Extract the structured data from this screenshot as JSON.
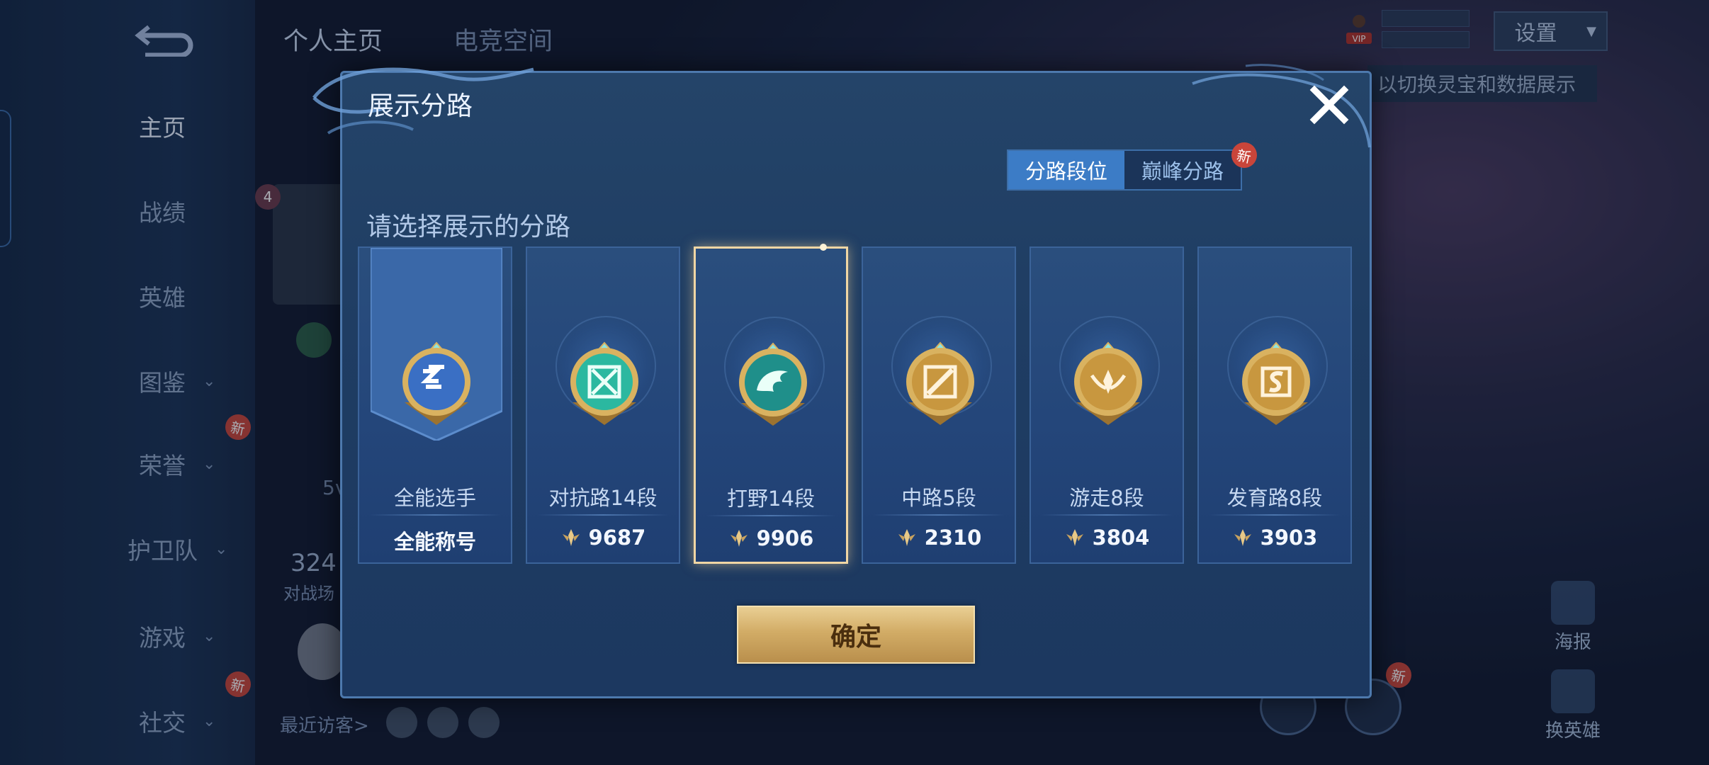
{
  "nav": {
    "items": [
      {
        "label": "主页",
        "active": true,
        "has_chevron": false,
        "badge": ""
      },
      {
        "label": "战绩",
        "active": false,
        "has_chevron": false,
        "badge": ""
      },
      {
        "label": "英雄",
        "active": false,
        "has_chevron": false,
        "badge": ""
      },
      {
        "label": "图鉴",
        "active": false,
        "has_chevron": true,
        "badge": ""
      },
      {
        "label": "荣誉",
        "active": false,
        "has_chevron": true,
        "badge": "新"
      },
      {
        "label": "护卫队",
        "active": false,
        "has_chevron": true,
        "badge": ""
      },
      {
        "label": "游戏",
        "active": false,
        "has_chevron": true,
        "badge": ""
      },
      {
        "label": "社交",
        "active": false,
        "has_chevron": true,
        "badge": "新"
      }
    ]
  },
  "header": {
    "tabs": [
      "个人主页",
      "电竞空间"
    ],
    "settings_label": "设置",
    "vip_label": "VIP",
    "hint": "以切换灵宝和数据展示"
  },
  "profile": {
    "level_badge": "4",
    "stat_number": "324",
    "stat_label": "对战场",
    "partial_text": "5v",
    "recent_visitors": "最近访客>"
  },
  "side_buttons": {
    "poster": "海报",
    "switch_hero": "换英雄",
    "new_badge": "新"
  },
  "dialog": {
    "title": "展示分路",
    "segments": [
      {
        "label": "分路段位",
        "active": true
      },
      {
        "label": "巅峰分路",
        "active": false
      }
    ],
    "segment_badge": "新",
    "subtitle": "请选择展示的分路",
    "cards": [
      {
        "title": "全能选手",
        "value": "全能称号",
        "emblem": "all-round-emblem-icon",
        "color": "#3a6fc4",
        "selected": false,
        "has_points_icon": false
      },
      {
        "title": "对抗路14段",
        "value": "9687",
        "emblem": "clash-lane-emblem-icon",
        "color": "#2bb8a0",
        "selected": false,
        "has_points_icon": true
      },
      {
        "title": "打野14段",
        "value": "9906",
        "emblem": "jungle-emblem-icon",
        "color": "#1f8f8a",
        "selected": true,
        "has_points_icon": true
      },
      {
        "title": "中路5段",
        "value": "2310",
        "emblem": "mid-lane-emblem-icon",
        "color": "#c8973f",
        "selected": false,
        "has_points_icon": true
      },
      {
        "title": "游走8段",
        "value": "3804",
        "emblem": "roam-emblem-icon",
        "color": "#c8973f",
        "selected": false,
        "has_points_icon": true
      },
      {
        "title": "发育路8段",
        "value": "3903",
        "emblem": "farm-lane-emblem-icon",
        "color": "#c8973f",
        "selected": false,
        "has_points_icon": true
      }
    ],
    "confirm_label": "确定"
  }
}
